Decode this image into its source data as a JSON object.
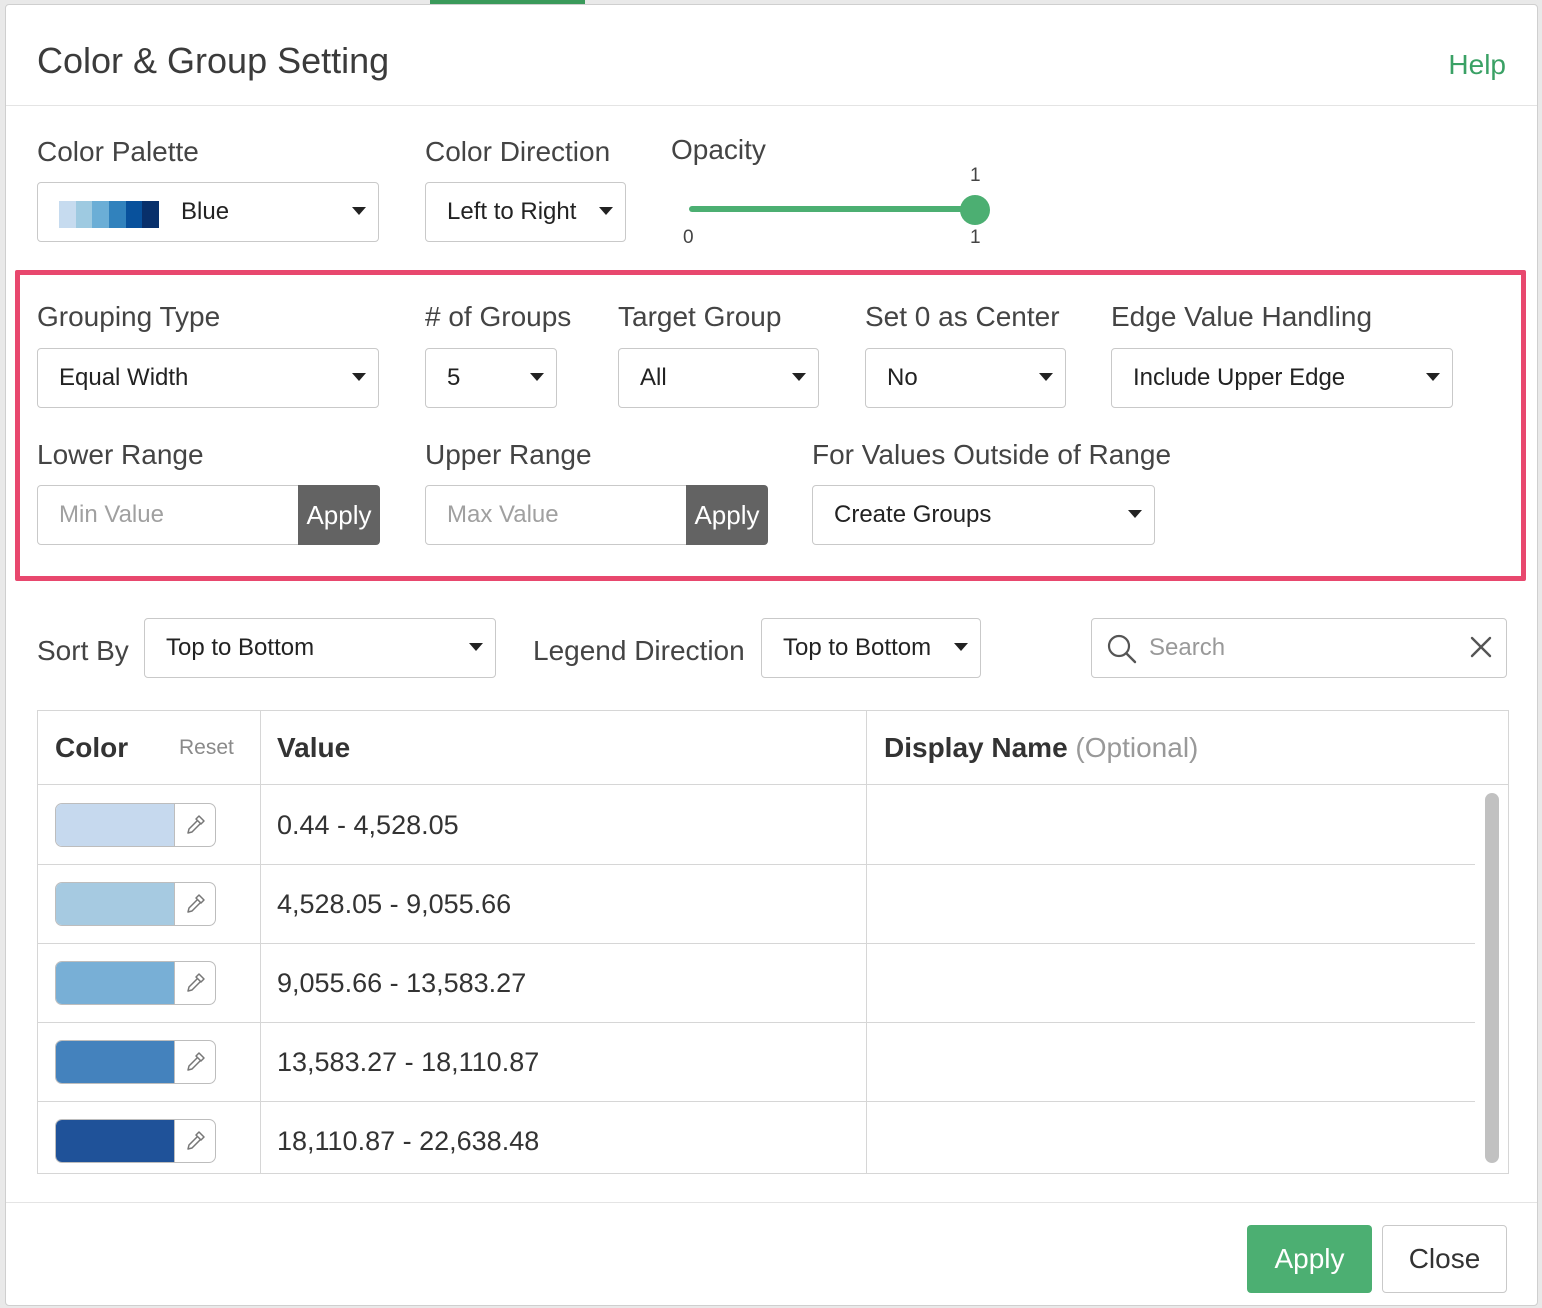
{
  "dialog": {
    "title": "Color & Group Setting",
    "help_label": "Help"
  },
  "settings": {
    "color_palette": {
      "label": "Color Palette",
      "value": "Blue",
      "swatch_colors": [
        "#c6dbef",
        "#9ecae1",
        "#6baed6",
        "#3182bd",
        "#08519c",
        "#08306b"
      ]
    },
    "color_direction": {
      "label": "Color Direction",
      "value": "Left to Right"
    },
    "opacity": {
      "label": "Opacity",
      "value": 1,
      "value_label": "1",
      "min_label": "0",
      "max_label": "1"
    }
  },
  "grouping": {
    "grouping_type": {
      "label": "Grouping Type",
      "value": "Equal Width"
    },
    "num_groups": {
      "label": "# of Groups",
      "value": "5"
    },
    "target_group": {
      "label": "Target Group",
      "value": "All"
    },
    "set_zero_center": {
      "label": "Set 0 as Center",
      "value": "No"
    },
    "edge_value_handling": {
      "label": "Edge Value Handling",
      "value": "Include Upper Edge"
    },
    "lower_range": {
      "label": "Lower Range",
      "placeholder": "Min Value",
      "apply_label": "Apply"
    },
    "upper_range": {
      "label": "Upper Range",
      "placeholder": "Max Value",
      "apply_label": "Apply"
    },
    "outside_range": {
      "label": "For Values Outside of Range",
      "value": "Create Groups"
    }
  },
  "toolbar": {
    "sort_by": {
      "label": "Sort By",
      "value": "Top to Bottom"
    },
    "legend_direction": {
      "label": "Legend Direction",
      "value": "Top to Bottom"
    },
    "search": {
      "placeholder": "Search"
    }
  },
  "table": {
    "headers": {
      "color": "Color",
      "reset": "Reset",
      "value": "Value",
      "display_name": "Display Name",
      "display_name_hint": "(Optional)"
    },
    "rows": [
      {
        "color": "#c6d9ee",
        "value": "0.44 - 4,528.05",
        "display_name": ""
      },
      {
        "color": "#a6cae1",
        "value": "4,528.05 - 9,055.66",
        "display_name": ""
      },
      {
        "color": "#78afd6",
        "value": "9,055.66 - 13,583.27",
        "display_name": ""
      },
      {
        "color": "#4482bd",
        "value": "13,583.27 - 18,110.87",
        "display_name": ""
      },
      {
        "color": "#1f5299",
        "value": "18,110.87 - 22,638.48",
        "display_name": ""
      }
    ]
  },
  "footer": {
    "apply_label": "Apply",
    "close_label": "Close"
  },
  "colors": {
    "accent_green": "#4caf72",
    "highlight_pink": "#e8486e",
    "inline_button_gray": "#636363"
  }
}
